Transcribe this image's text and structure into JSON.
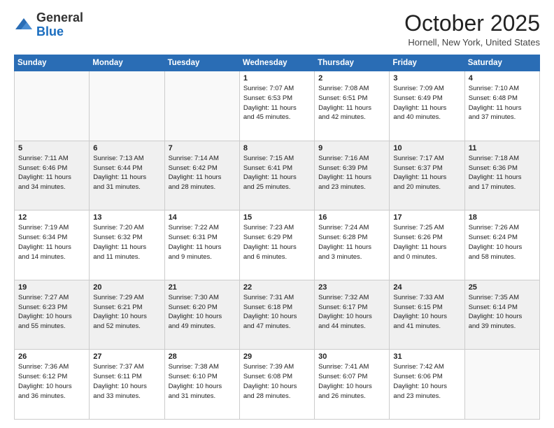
{
  "logo": {
    "general": "General",
    "blue": "Blue"
  },
  "header": {
    "month_year": "October 2025",
    "location": "Hornell, New York, United States"
  },
  "days_of_week": [
    "Sunday",
    "Monday",
    "Tuesday",
    "Wednesday",
    "Thursday",
    "Friday",
    "Saturday"
  ],
  "weeks": [
    {
      "shaded": false,
      "days": [
        {
          "num": "",
          "info": ""
        },
        {
          "num": "",
          "info": ""
        },
        {
          "num": "",
          "info": ""
        },
        {
          "num": "1",
          "info": "Sunrise: 7:07 AM\nSunset: 6:53 PM\nDaylight: 11 hours\nand 45 minutes."
        },
        {
          "num": "2",
          "info": "Sunrise: 7:08 AM\nSunset: 6:51 PM\nDaylight: 11 hours\nand 42 minutes."
        },
        {
          "num": "3",
          "info": "Sunrise: 7:09 AM\nSunset: 6:49 PM\nDaylight: 11 hours\nand 40 minutes."
        },
        {
          "num": "4",
          "info": "Sunrise: 7:10 AM\nSunset: 6:48 PM\nDaylight: 11 hours\nand 37 minutes."
        }
      ]
    },
    {
      "shaded": true,
      "days": [
        {
          "num": "5",
          "info": "Sunrise: 7:11 AM\nSunset: 6:46 PM\nDaylight: 11 hours\nand 34 minutes."
        },
        {
          "num": "6",
          "info": "Sunrise: 7:13 AM\nSunset: 6:44 PM\nDaylight: 11 hours\nand 31 minutes."
        },
        {
          "num": "7",
          "info": "Sunrise: 7:14 AM\nSunset: 6:42 PM\nDaylight: 11 hours\nand 28 minutes."
        },
        {
          "num": "8",
          "info": "Sunrise: 7:15 AM\nSunset: 6:41 PM\nDaylight: 11 hours\nand 25 minutes."
        },
        {
          "num": "9",
          "info": "Sunrise: 7:16 AM\nSunset: 6:39 PM\nDaylight: 11 hours\nand 23 minutes."
        },
        {
          "num": "10",
          "info": "Sunrise: 7:17 AM\nSunset: 6:37 PM\nDaylight: 11 hours\nand 20 minutes."
        },
        {
          "num": "11",
          "info": "Sunrise: 7:18 AM\nSunset: 6:36 PM\nDaylight: 11 hours\nand 17 minutes."
        }
      ]
    },
    {
      "shaded": false,
      "days": [
        {
          "num": "12",
          "info": "Sunrise: 7:19 AM\nSunset: 6:34 PM\nDaylight: 11 hours\nand 14 minutes."
        },
        {
          "num": "13",
          "info": "Sunrise: 7:20 AM\nSunset: 6:32 PM\nDaylight: 11 hours\nand 11 minutes."
        },
        {
          "num": "14",
          "info": "Sunrise: 7:22 AM\nSunset: 6:31 PM\nDaylight: 11 hours\nand 9 minutes."
        },
        {
          "num": "15",
          "info": "Sunrise: 7:23 AM\nSunset: 6:29 PM\nDaylight: 11 hours\nand 6 minutes."
        },
        {
          "num": "16",
          "info": "Sunrise: 7:24 AM\nSunset: 6:28 PM\nDaylight: 11 hours\nand 3 minutes."
        },
        {
          "num": "17",
          "info": "Sunrise: 7:25 AM\nSunset: 6:26 PM\nDaylight: 11 hours\nand 0 minutes."
        },
        {
          "num": "18",
          "info": "Sunrise: 7:26 AM\nSunset: 6:24 PM\nDaylight: 10 hours\nand 58 minutes."
        }
      ]
    },
    {
      "shaded": true,
      "days": [
        {
          "num": "19",
          "info": "Sunrise: 7:27 AM\nSunset: 6:23 PM\nDaylight: 10 hours\nand 55 minutes."
        },
        {
          "num": "20",
          "info": "Sunrise: 7:29 AM\nSunset: 6:21 PM\nDaylight: 10 hours\nand 52 minutes."
        },
        {
          "num": "21",
          "info": "Sunrise: 7:30 AM\nSunset: 6:20 PM\nDaylight: 10 hours\nand 49 minutes."
        },
        {
          "num": "22",
          "info": "Sunrise: 7:31 AM\nSunset: 6:18 PM\nDaylight: 10 hours\nand 47 minutes."
        },
        {
          "num": "23",
          "info": "Sunrise: 7:32 AM\nSunset: 6:17 PM\nDaylight: 10 hours\nand 44 minutes."
        },
        {
          "num": "24",
          "info": "Sunrise: 7:33 AM\nSunset: 6:15 PM\nDaylight: 10 hours\nand 41 minutes."
        },
        {
          "num": "25",
          "info": "Sunrise: 7:35 AM\nSunset: 6:14 PM\nDaylight: 10 hours\nand 39 minutes."
        }
      ]
    },
    {
      "shaded": false,
      "days": [
        {
          "num": "26",
          "info": "Sunrise: 7:36 AM\nSunset: 6:12 PM\nDaylight: 10 hours\nand 36 minutes."
        },
        {
          "num": "27",
          "info": "Sunrise: 7:37 AM\nSunset: 6:11 PM\nDaylight: 10 hours\nand 33 minutes."
        },
        {
          "num": "28",
          "info": "Sunrise: 7:38 AM\nSunset: 6:10 PM\nDaylight: 10 hours\nand 31 minutes."
        },
        {
          "num": "29",
          "info": "Sunrise: 7:39 AM\nSunset: 6:08 PM\nDaylight: 10 hours\nand 28 minutes."
        },
        {
          "num": "30",
          "info": "Sunrise: 7:41 AM\nSunset: 6:07 PM\nDaylight: 10 hours\nand 26 minutes."
        },
        {
          "num": "31",
          "info": "Sunrise: 7:42 AM\nSunset: 6:06 PM\nDaylight: 10 hours\nand 23 minutes."
        },
        {
          "num": "",
          "info": ""
        }
      ]
    }
  ]
}
